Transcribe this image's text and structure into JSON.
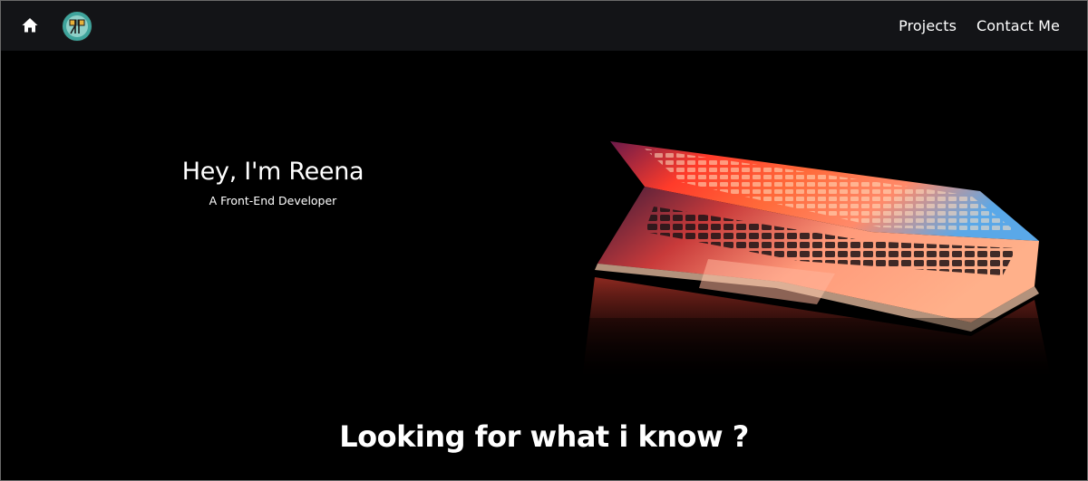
{
  "nav": {
    "home_icon": "home-icon",
    "logo_icon": "rp-monogram-logo",
    "links": [
      {
        "label": "Projects"
      },
      {
        "label": "Contact Me"
      }
    ]
  },
  "hero": {
    "title": "Hey, I'm Reena",
    "subtitle": "A Front-End Developer",
    "image": "laptop-glowing-keyboard-photo"
  },
  "section": {
    "heading": "Looking for what i know ?"
  },
  "colors": {
    "page_bg": "#000000",
    "navbar_bg": "#131417",
    "text": "#ffffff",
    "logo_bg": "#3fa49c",
    "laptop_glow_red": "#ff3b2a",
    "laptop_glow_orange": "#ff8a3a",
    "laptop_glow_blue": "#4aa8ff"
  }
}
